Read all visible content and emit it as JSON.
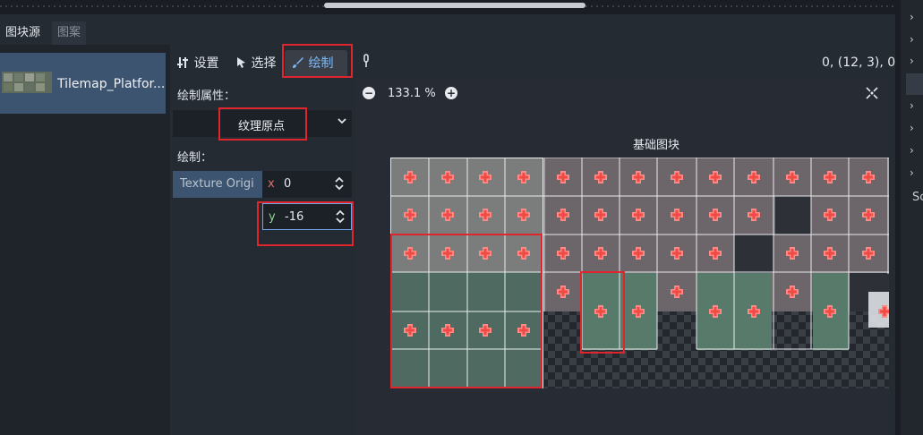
{
  "tabs": {
    "tile_sources": "图块源",
    "patterns": "图案"
  },
  "source_item": {
    "label": "Tilemap_Platfor..."
  },
  "toolbar": {
    "setup": "设置",
    "select": "选择",
    "paint": "绘制",
    "setup_icon": "setup-icon",
    "select_icon": "cursor-icon",
    "paint_icon": "brush-icon",
    "pin_icon": "pin-icon"
  },
  "coordinates": "0, (12, 3), 0",
  "properties": {
    "paint_properties_label": "绘制属性：",
    "dropdown_value": "纹理原点",
    "paint_label": "绘制：",
    "property_name": "Texture Origi",
    "x_label": "x",
    "x_value": "0",
    "y_label": "y",
    "y_value": "-16"
  },
  "viewer": {
    "zoom": "133.1 %",
    "atlas_title": "基础图块"
  },
  "right_panel": {
    "label_fragment": "Sc"
  },
  "colors": {
    "highlight": "#e0262d",
    "accent": "#70a7e8",
    "selection": "#3d5470",
    "x_axis": "#d9736a",
    "y_axis": "#8cd68e"
  }
}
